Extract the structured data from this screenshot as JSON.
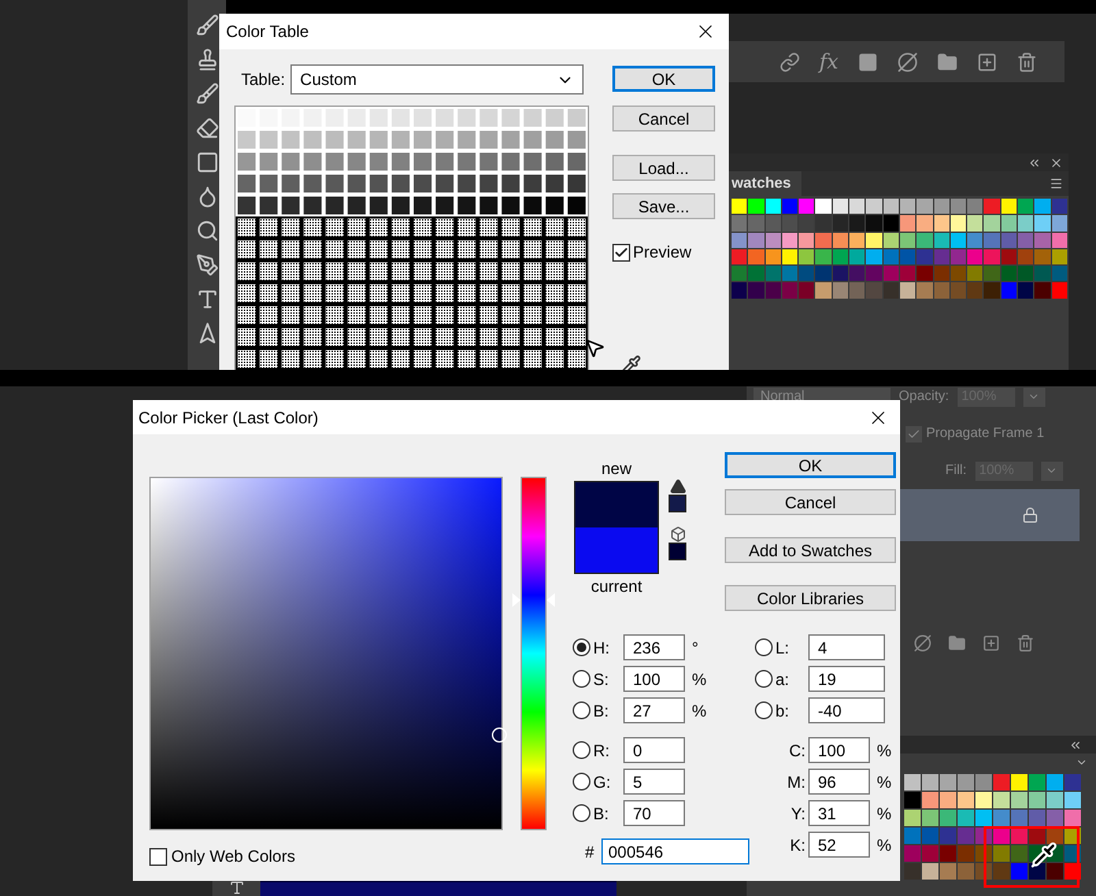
{
  "top": {
    "color_table_dialog": {
      "title": "Color Table",
      "table_label": "Table:",
      "table_value": "Custom",
      "buttons": [
        {
          "label": "OK",
          "default": true
        },
        {
          "label": "Cancel",
          "default": false
        },
        {
          "label": "Load...",
          "default": false
        },
        {
          "label": "Save...",
          "default": false
        }
      ],
      "preview": {
        "label": "Preview",
        "checked": true
      }
    },
    "layers_toolbar": {
      "fx_label": "fx"
    },
    "swatches_panel": {
      "tab": "watches",
      "rows": [
        [
          {
            "color": "#ffff00"
          },
          {
            "color": "#00ff00"
          },
          {
            "color": "#00ffff"
          },
          {
            "color": "#0000ff"
          },
          {
            "color": "#ff00ff"
          },
          {
            "color": "#ffffff"
          },
          {
            "color": "#e6e6e6"
          },
          {
            "color": "#d9d9d9"
          },
          {
            "color": "#cccccc"
          },
          {
            "color": "#bfbfbf"
          },
          {
            "color": "#b3b3b3"
          },
          {
            "color": "#a6a6a6"
          },
          {
            "color": "#999999"
          },
          {
            "color": "#8c8c8c"
          },
          {
            "color": "#808080"
          },
          {
            "color": "#ed1c24"
          },
          {
            "color": "#fff200"
          },
          {
            "color": "#00a651"
          },
          {
            "color": "#00aeef"
          },
          {
            "color": "#2e3192"
          }
        ],
        [
          {
            "color": "#737373"
          },
          {
            "color": "#666666"
          },
          {
            "color": "#595959"
          },
          {
            "color": "#4d4d4d"
          },
          {
            "color": "#404040"
          },
          {
            "color": "#333333"
          },
          {
            "color": "#262626"
          },
          {
            "color": "#1a1a1a"
          },
          {
            "color": "#0d0d0d"
          },
          {
            "color": "#000000"
          },
          {
            "color": "#f7977a"
          },
          {
            "color": "#f9ad81"
          },
          {
            "color": "#fdc68a"
          },
          {
            "color": "#fff79a"
          },
          {
            "color": "#c4df9b"
          },
          {
            "color": "#a3d39c"
          },
          {
            "color": "#82ca9d"
          },
          {
            "color": "#7bcdc8"
          },
          {
            "color": "#6ecff6"
          },
          {
            "color": "#7ea7d8"
          }
        ],
        [
          {
            "color": "#8493ca"
          },
          {
            "color": "#a187be"
          },
          {
            "color": "#bc8dbf"
          },
          {
            "color": "#f49ac2"
          },
          {
            "color": "#f6989d"
          },
          {
            "color": "#f26c4f"
          },
          {
            "color": "#f68e55"
          },
          {
            "color": "#fbaf5c"
          },
          {
            "color": "#fff467"
          },
          {
            "color": "#acd372"
          },
          {
            "color": "#7cc576"
          },
          {
            "color": "#3bb878"
          },
          {
            "color": "#1abbb4"
          },
          {
            "color": "#00bff3"
          },
          {
            "color": "#448ccb"
          },
          {
            "color": "#5574b9"
          },
          {
            "color": "#605ca8"
          },
          {
            "color": "#855fa8"
          },
          {
            "color": "#a763a8"
          },
          {
            "color": "#f06eaa"
          }
        ],
        [
          {
            "color": "#ed1c24"
          },
          {
            "color": "#f26522"
          },
          {
            "color": "#f7941d"
          },
          {
            "color": "#fff200"
          },
          {
            "color": "#8dc63f"
          },
          {
            "color": "#39b54a"
          },
          {
            "color": "#00a651"
          },
          {
            "color": "#00a99d"
          },
          {
            "color": "#00aeef"
          },
          {
            "color": "#0072bc"
          },
          {
            "color": "#0054a6"
          },
          {
            "color": "#2e3192"
          },
          {
            "color": "#662d91"
          },
          {
            "color": "#92278f"
          },
          {
            "color": "#ec008c"
          },
          {
            "color": "#ed145b"
          },
          {
            "color": "#9e0b0f"
          },
          {
            "color": "#a0410d"
          },
          {
            "color": "#a36209"
          },
          {
            "color": "#aba000"
          }
        ],
        [
          {
            "color": "#1a7b30"
          },
          {
            "color": "#007236"
          },
          {
            "color": "#00746b"
          },
          {
            "color": "#0076a3"
          },
          {
            "color": "#004b80"
          },
          {
            "color": "#003471"
          },
          {
            "color": "#1b1464"
          },
          {
            "color": "#440e62"
          },
          {
            "color": "#630460"
          },
          {
            "color": "#9e005d"
          },
          {
            "color": "#9e0039"
          },
          {
            "color": "#790000"
          },
          {
            "color": "#7b2e00"
          },
          {
            "color": "#7d4900"
          },
          {
            "color": "#827b00"
          },
          {
            "color": "#406618"
          },
          {
            "color": "#005e20"
          },
          {
            "color": "#005826"
          },
          {
            "color": "#005952"
          },
          {
            "color": "#005b7f"
          }
        ],
        [
          {
            "color": "#0d004c"
          },
          {
            "color": "#32004b"
          },
          {
            "color": "#4b0049"
          },
          {
            "color": "#7b0046"
          },
          {
            "color": "#7a0026"
          },
          {
            "color": "#c69c6d"
          },
          {
            "color": "#998675"
          },
          {
            "color": "#736357"
          },
          {
            "color": "#534741"
          },
          {
            "color": "#37302a"
          },
          {
            "color": "#c7b299"
          },
          {
            "color": "#a67c52"
          },
          {
            "color": "#8c6239"
          },
          {
            "color": "#754c24"
          },
          {
            "color": "#603913"
          },
          {
            "color": "#3d2005"
          },
          {
            "color": "#0000ff"
          },
          {
            "color": "#000546"
          },
          {
            "color": "#4b0000"
          },
          {
            "color": "#ff0000"
          }
        ]
      ]
    }
  },
  "bottom": {
    "layers_panel": {
      "blend_mode": "Normal",
      "opacity_label": "Opacity:",
      "opacity_value": "100%",
      "propagate": {
        "label": "Propagate Frame 1",
        "checked": true
      },
      "fill_label": "Fill:",
      "fill_value": "100%"
    },
    "color_picker": {
      "title": "Color Picker (Last Color)",
      "new_label": "new",
      "current_label": "current",
      "new_preview": {
        "color": "#000546"
      },
      "current_preview": {
        "color": "#0a0af0"
      },
      "gamut_swatch": {
        "color": "#131a4a"
      },
      "web_swatch": {
        "color": "#000033"
      },
      "buttons": [
        {
          "label": "OK",
          "default": true
        },
        {
          "label": "Cancel",
          "default": false
        },
        {
          "label": "Add to Swatches",
          "default": false
        },
        {
          "label": "Color Libraries",
          "default": false
        }
      ],
      "hsb": [
        {
          "label": "H:",
          "value": "236",
          "unit": "°",
          "selected": true
        },
        {
          "label": "S:",
          "value": "100",
          "unit": "%",
          "selected": false
        },
        {
          "label": "B:",
          "value": "27",
          "unit": "%",
          "selected": false
        }
      ],
      "rgb": [
        {
          "label": "R:",
          "value": "0",
          "selected": false
        },
        {
          "label": "G:",
          "value": "5",
          "selected": false
        },
        {
          "label": "B:",
          "value": "70",
          "selected": false
        }
      ],
      "lab": [
        {
          "label": "L:",
          "value": "4",
          "selected": false
        },
        {
          "label": "a:",
          "value": "19",
          "selected": false
        },
        {
          "label": "b:",
          "value": "-40",
          "selected": false
        }
      ],
      "cmyk": [
        {
          "label": "C:",
          "value": "100",
          "unit": "%"
        },
        {
          "label": "M:",
          "value": "96",
          "unit": "%"
        },
        {
          "label": "Y:",
          "value": "31",
          "unit": "%"
        },
        {
          "label": "K:",
          "value": "52",
          "unit": "%"
        }
      ],
      "hex_label": "#",
      "hex_value": "000546",
      "only_web_colors": {
        "label": "Only Web Colors",
        "checked": false
      }
    },
    "swatches": {
      "rows": [
        [
          {
            "color": "#c0c0c0"
          },
          {
            "color": "#b3b3b3"
          },
          {
            "color": "#a6a6a6"
          },
          {
            "color": "#999999"
          },
          {
            "color": "#8c8c8c"
          },
          {
            "color": "#ed1c24"
          },
          {
            "color": "#fff200"
          },
          {
            "color": "#00a651"
          },
          {
            "color": "#00aeef"
          },
          {
            "color": "#2e3192"
          }
        ],
        [
          {
            "color": "#000000"
          },
          {
            "color": "#f7977a"
          },
          {
            "color": "#f9ad81"
          },
          {
            "color": "#fdc68a"
          },
          {
            "color": "#fff79a"
          },
          {
            "color": "#c4df9b"
          },
          {
            "color": "#a3d39c"
          },
          {
            "color": "#82ca9d"
          },
          {
            "color": "#7bcdc8"
          },
          {
            "color": "#6ecff6"
          }
        ],
        [
          {
            "color": "#acd372"
          },
          {
            "color": "#7cc576"
          },
          {
            "color": "#3bb878"
          },
          {
            "color": "#1abbb4"
          },
          {
            "color": "#00bff3"
          },
          {
            "color": "#448ccb"
          },
          {
            "color": "#5574b9"
          },
          {
            "color": "#605ca8"
          },
          {
            "color": "#855fa8"
          },
          {
            "color": "#f06eaa"
          }
        ],
        [
          {
            "color": "#0072bc"
          },
          {
            "color": "#0054a6"
          },
          {
            "color": "#2e3192"
          },
          {
            "color": "#662d91"
          },
          {
            "color": "#92278f"
          },
          {
            "color": "#ec008c"
          },
          {
            "color": "#ed145b"
          },
          {
            "color": "#9e0b0f"
          },
          {
            "color": "#a0410d"
          },
          {
            "color": "#aba000"
          }
        ],
        [
          {
            "color": "#9e005d"
          },
          {
            "color": "#9e0039"
          },
          {
            "color": "#790000"
          },
          {
            "color": "#7b2e00"
          },
          {
            "color": "#7d4900"
          },
          {
            "color": "#827b00"
          },
          {
            "color": "#406618"
          },
          {
            "color": "#005e20"
          },
          {
            "color": "#005826"
          },
          {
            "color": "#005b7f"
          }
        ],
        [
          {
            "color": "#37302a"
          },
          {
            "color": "#c7b299"
          },
          {
            "color": "#a67c52"
          },
          {
            "color": "#8c6239"
          },
          {
            "color": "#754c24"
          },
          {
            "color": "#603913"
          },
          {
            "color": "#0000ff"
          },
          {
            "color": "#000546"
          },
          {
            "color": "#4b0000"
          },
          {
            "color": "#ff0000"
          }
        ]
      ]
    }
  }
}
